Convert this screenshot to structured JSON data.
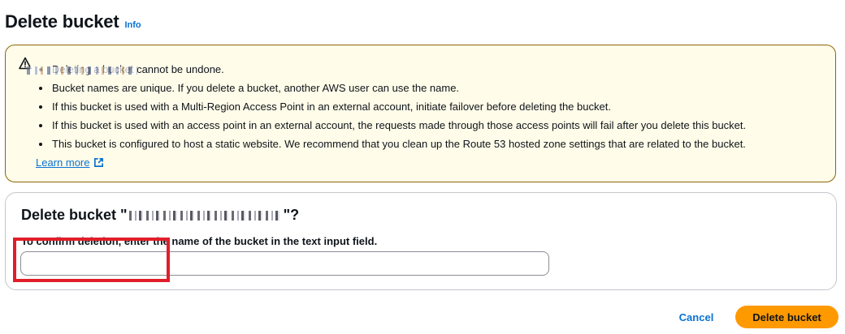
{
  "header": {
    "title": "Delete bucket",
    "info_link": "Info"
  },
  "warning": {
    "icon": "warning-icon",
    "items": [
      "Deleting a bucket cannot be undone.",
      "Bucket names are unique. If you delete a bucket, another AWS user can use the name.",
      "If this bucket is used with a Multi-Region Access Point in an external account, initiate failover before deleting the bucket.",
      "If this bucket is used with an access point in an external account, the requests made through those access points will fail after you delete this bucket.",
      "This bucket is configured to host a static website. We recommend that you clean up the Route 53 hosted zone settings that are related to the bucket."
    ],
    "learn_more": "Learn more",
    "colors": {
      "background": "#fffce9",
      "border": "#8d6605"
    }
  },
  "confirm": {
    "heading_prefix": "Delete bucket \"",
    "heading_suffix": "\"?",
    "label": "To confirm deletion, enter the name of the bucket in the text input field.",
    "input_value": ""
  },
  "actions": {
    "cancel": "Cancel",
    "delete": "Delete bucket",
    "colors": {
      "link": "#0972d3",
      "primary": "#ff9900",
      "highlight": "#e01e2a"
    }
  }
}
